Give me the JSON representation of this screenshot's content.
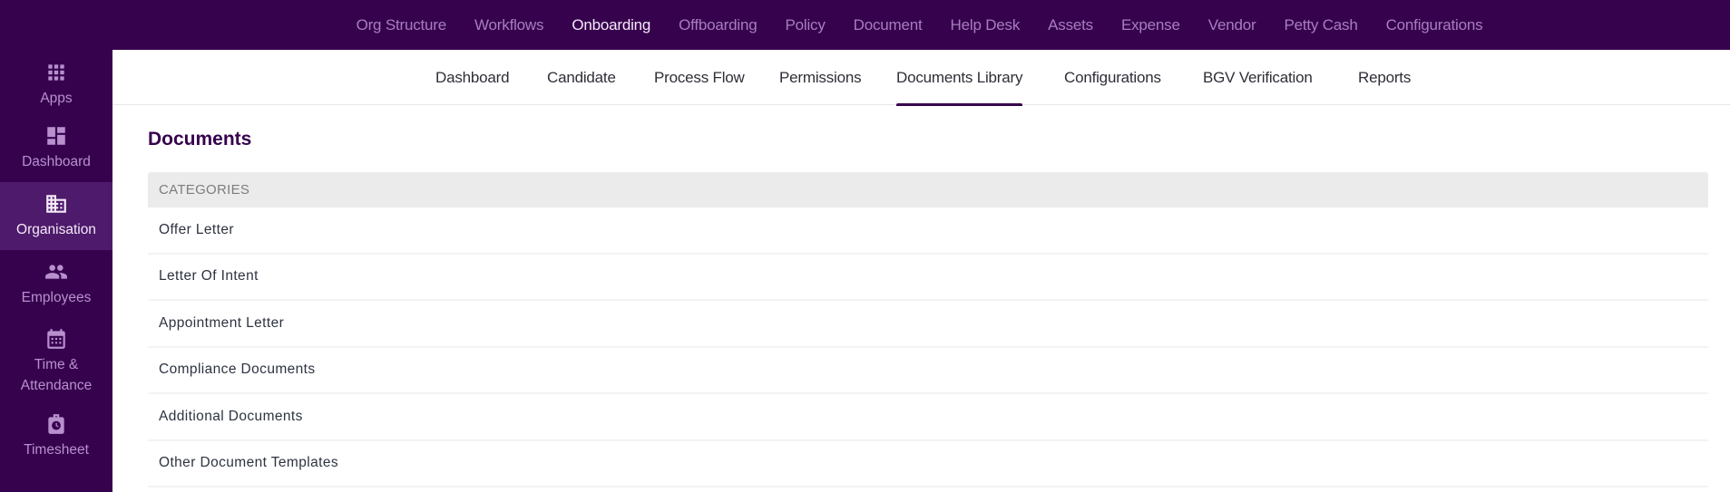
{
  "topnav": {
    "items": [
      {
        "label": "Org Structure",
        "active": false
      },
      {
        "label": "Workflows",
        "active": false
      },
      {
        "label": "Onboarding",
        "active": true
      },
      {
        "label": "Offboarding",
        "active": false
      },
      {
        "label": "Policy",
        "active": false
      },
      {
        "label": "Document",
        "active": false
      },
      {
        "label": "Help Desk",
        "active": false
      },
      {
        "label": "Assets",
        "active": false
      },
      {
        "label": "Expense",
        "active": false
      },
      {
        "label": "Vendor",
        "active": false
      },
      {
        "label": "Petty Cash",
        "active": false
      },
      {
        "label": "Configurations",
        "active": false
      }
    ]
  },
  "sidebar": {
    "items": [
      {
        "label": "Apps",
        "icon": "apps-grid-icon",
        "active": false
      },
      {
        "label": "Dashboard",
        "icon": "dashboard-icon",
        "active": false
      },
      {
        "label": "Organisation",
        "icon": "building-icon",
        "active": true
      },
      {
        "label": "Employees",
        "icon": "people-icon",
        "active": false
      },
      {
        "label": "Time & Attendance",
        "icon": "calendar-icon",
        "active": false
      },
      {
        "label": "Timesheet",
        "icon": "timesheet-clock-icon",
        "active": false
      }
    ]
  },
  "subnav": {
    "items": [
      {
        "label": "Dashboard",
        "active": false
      },
      {
        "label": "Candidate",
        "active": false
      },
      {
        "label": "Process Flow",
        "active": false
      },
      {
        "label": "Permissions",
        "active": false
      },
      {
        "label": "Documents Library",
        "active": true
      },
      {
        "label": "Configurations",
        "active": false
      },
      {
        "label": "BGV Verification",
        "active": false
      },
      {
        "label": "Reports",
        "active": false
      }
    ]
  },
  "main": {
    "title": "Documents",
    "categories_header": "CATEGORIES",
    "categories": [
      "Offer Letter",
      "Letter Of Intent",
      "Appointment Letter",
      "Compliance Documents",
      "Additional Documents",
      "Other Document Templates"
    ]
  },
  "colors": {
    "brand": "#36024e",
    "sidebar_active": "#4e1a6b",
    "nav_inactive": "#a77dbd"
  }
}
